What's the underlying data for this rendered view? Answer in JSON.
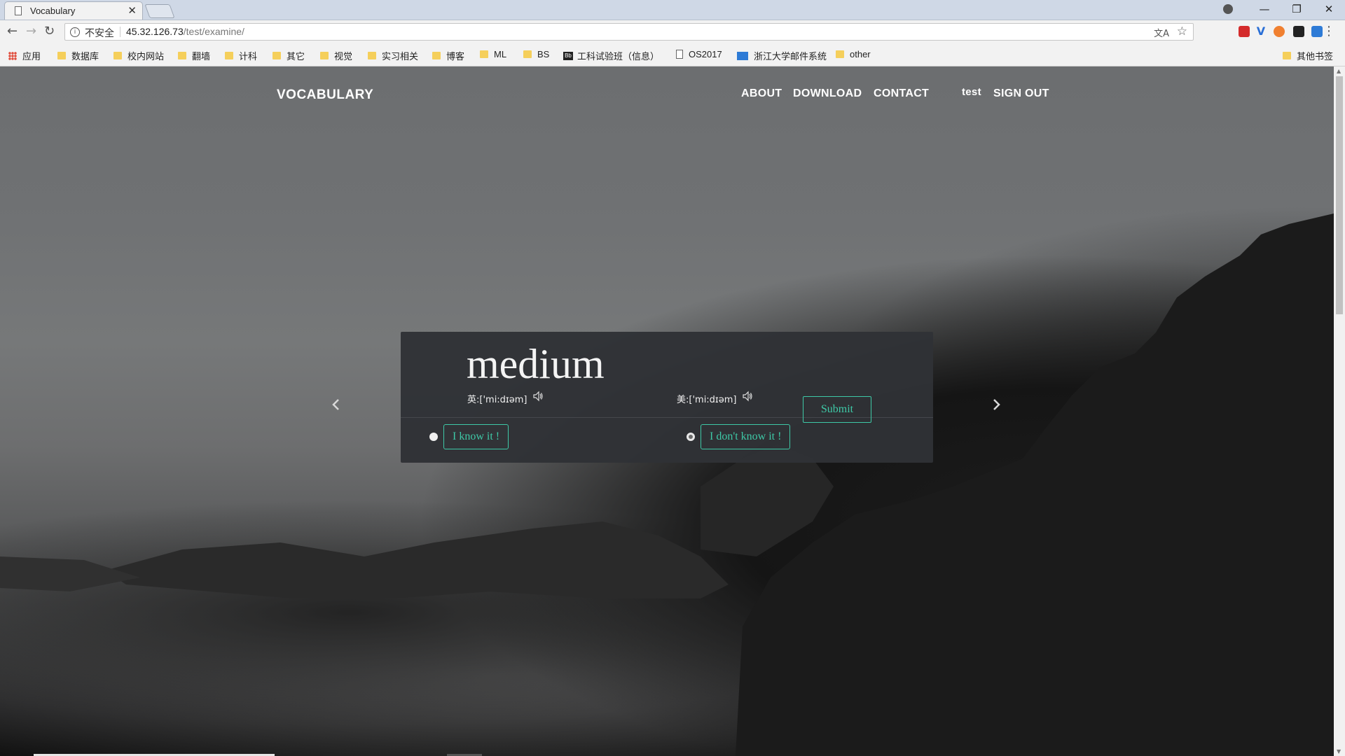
{
  "browser": {
    "tab_title": "Vocabulary",
    "tab_close": "✕",
    "window_controls": [
      "—",
      "❐",
      "✕"
    ],
    "insecure_label": "不安全",
    "url_host": "45.32.126.73",
    "url_path": "/test/examine/",
    "bookmarks": [
      {
        "label": "应用",
        "icon": "apps-icon"
      },
      {
        "label": "数据库",
        "icon": "folder-icon"
      },
      {
        "label": "校内网站",
        "icon": "folder-icon"
      },
      {
        "label": "翻墙",
        "icon": "folder-icon"
      },
      {
        "label": "计科",
        "icon": "folder-icon"
      },
      {
        "label": "其它",
        "icon": "folder-icon"
      },
      {
        "label": "视觉",
        "icon": "folder-icon"
      },
      {
        "label": "实习相关",
        "icon": "folder-icon"
      },
      {
        "label": "博客",
        "icon": "folder-icon"
      },
      {
        "label": "ML",
        "icon": "folder-icon"
      },
      {
        "label": "BS",
        "icon": "folder-icon"
      },
      {
        "label": "工科试验班（信息）",
        "icon": "bb-icon"
      },
      {
        "label": "OS2017",
        "icon": "page-icon"
      },
      {
        "label": "浙江大学邮件系统",
        "icon": "mail-icon"
      },
      {
        "label": "other",
        "icon": "folder-icon"
      }
    ],
    "other_bookmarks": "其他书签",
    "colors": {
      "accent": "#3ec9a7",
      "card_bg": "#303236"
    }
  },
  "site": {
    "brand": "VOCABULARY",
    "nav": {
      "about": "ABOUT",
      "download": "DOWNLOAD",
      "contact": "CONTACT",
      "user": "test",
      "sign_out": "SIGN OUT"
    }
  },
  "card": {
    "word": "medium",
    "uk_phonetic": "英:['mi:dɪəm]",
    "us_phonetic": "美:['mi:dɪəm]",
    "option_know": "I know it !",
    "option_dont_know": "I don't know it !",
    "submit": "Submit"
  }
}
